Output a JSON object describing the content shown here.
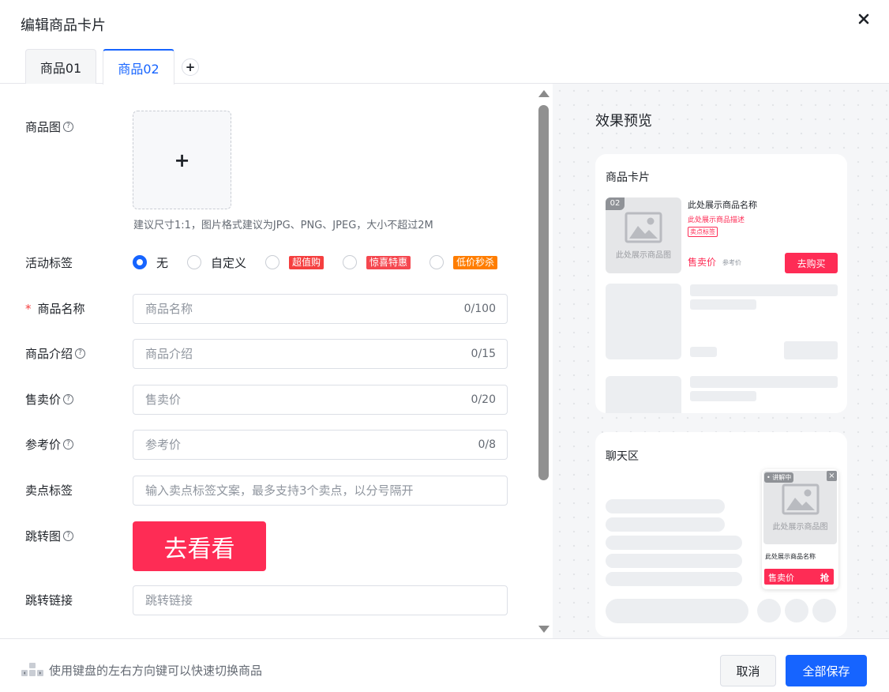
{
  "header": {
    "title": "编辑商品卡片"
  },
  "tabs": [
    {
      "label": "商品01"
    },
    {
      "label": "商品02"
    }
  ],
  "form": {
    "image": {
      "label": "商品图",
      "hint": "建议尺寸1:1，图片格式建议为JPG、PNG、JPEG，大小不超过2M"
    },
    "activity_tag": {
      "label": "活动标签",
      "options": [
        {
          "label": "无"
        },
        {
          "label": "自定义"
        },
        {
          "label": "超值购",
          "color": "#f53f3f"
        },
        {
          "label": "惊喜特惠",
          "color": "#f5474f"
        },
        {
          "label": "低价秒杀",
          "color": "#ff7d00"
        }
      ]
    },
    "name": {
      "label": "商品名称",
      "placeholder": "商品名称",
      "count": "0/100"
    },
    "intro": {
      "label": "商品介绍",
      "placeholder": "商品介绍",
      "count": "0/15"
    },
    "price": {
      "label": "售卖价",
      "placeholder": "售卖价",
      "count": "0/20"
    },
    "ref_price": {
      "label": "参考价",
      "placeholder": "参考价",
      "count": "0/8"
    },
    "selling_tags": {
      "label": "卖点标签",
      "placeholder": "输入卖点标签文案，最多支持3个卖点，以分号隔开"
    },
    "jump_image": {
      "label": "跳转图",
      "text": "去看看"
    },
    "jump_link": {
      "label": "跳转链接",
      "placeholder": "跳转链接"
    }
  },
  "preview": {
    "title": "效果预览",
    "product_card": {
      "title": "商品卡片",
      "index": "02",
      "image_text": "此处展示商品图",
      "name": "此处展示商品名称",
      "desc": "此处展示商品描述",
      "tag": "卖点标签",
      "price": "售卖价",
      "ref": "参考价",
      "buy": "去购买"
    },
    "chat": {
      "title": "聊天区",
      "live_badge": "讲解中",
      "image_text": "此处展示商品图",
      "name": "此处展示商品名称",
      "price": "售卖价",
      "grab": "抢"
    }
  },
  "footer": {
    "hint": "使用键盘的左右方向键可以快速切换商品",
    "cancel": "取消",
    "save": "全部保存"
  },
  "colors": {
    "primary": "#1664ff",
    "accent": "#fe2c55"
  }
}
